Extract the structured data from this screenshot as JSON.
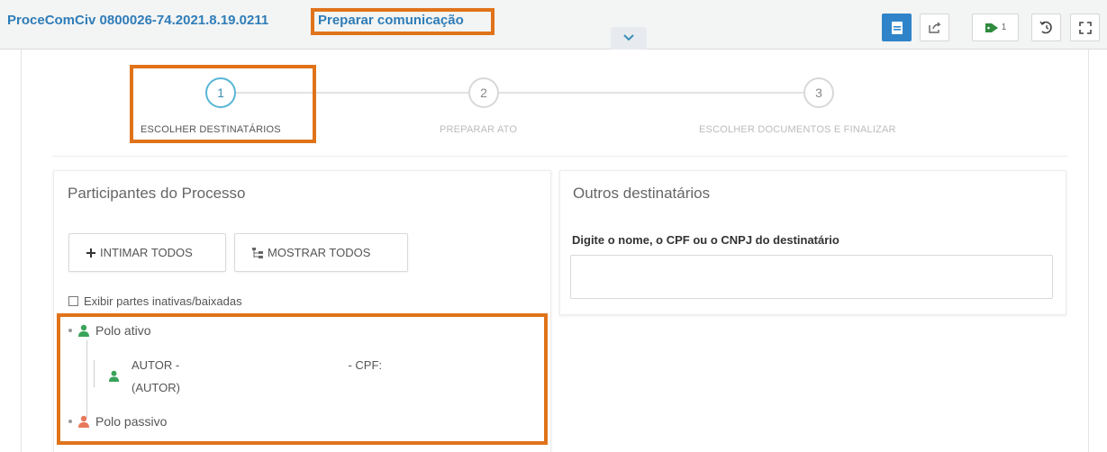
{
  "header": {
    "process_number": "ProceComCiv 0800026-74.2021.8.19.0211",
    "action_title": "Preparar comunicação",
    "toolbar": {
      "tags_count": "1"
    }
  },
  "stepper": {
    "steps": [
      {
        "number": "1",
        "label": "ESCOLHER DESTINATÁRIOS",
        "active": true
      },
      {
        "number": "2",
        "label": "PREPARAR ATO",
        "active": false
      },
      {
        "number": "3",
        "label": "ESCOLHER DOCUMENTOS E FINALIZAR",
        "active": false
      }
    ]
  },
  "participants": {
    "title": "Participantes do Processo",
    "intimar_todos_label": "INTIMAR TODOS",
    "mostrar_todos_label": "MOSTRAR TODOS",
    "show_inactive_label": "Exibir partes inativas/baixadas",
    "tree": {
      "polo_ativo_label": "Polo ativo",
      "autor_name_prefix": "AUTOR -",
      "autor_cpf_label": "- CPF:",
      "autor_role": "(AUTOR)",
      "polo_passivo_label": "Polo passivo"
    }
  },
  "other_recipients": {
    "title": "Outros destinatários",
    "field_label": "Digite o nome, o CPF ou o CNPJ do destinatário",
    "field_value": ""
  },
  "colors": {
    "highlight": "#e0731a",
    "link_blue": "#2f7db8",
    "active_step": "#58b5d6",
    "primary_button": "#2f84c9",
    "polo_ativo_icon": "#3aa35a",
    "polo_passivo_icon": "#e8795a"
  },
  "icons": {
    "expand": "chevron-down-icon",
    "details": "document-icon",
    "share": "share-icon",
    "tags": "tag-icon",
    "history": "history-icon",
    "fullscreen": "fullscreen-icon",
    "intimar": "plus-icon",
    "mostrar": "tree-icon",
    "polo": "person-icon"
  }
}
